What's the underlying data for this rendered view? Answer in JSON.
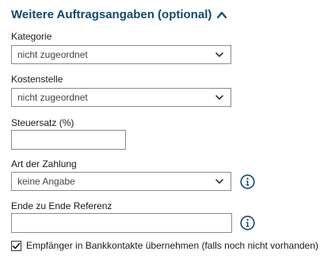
{
  "section": {
    "title": "Weitere Auftragsangaben (optional)",
    "expanded": true
  },
  "fields": {
    "kategorie": {
      "label": "Kategorie",
      "value": "nicht zugeordnet"
    },
    "kostenstelle": {
      "label": "Kostenstelle",
      "value": "nicht zugeordnet"
    },
    "steuersatz": {
      "label": "Steuersatz (%)",
      "value": ""
    },
    "zahlungsart": {
      "label": "Art der Zahlung",
      "value": "keine Angabe"
    },
    "referenz": {
      "label": "Ende zu Ende Referenz",
      "value": ""
    }
  },
  "checkbox": {
    "label": "Empfänger in Bankkontakte übernehmen (falls noch nicht vorhanden)",
    "checked": true
  },
  "colors": {
    "heading": "#0f4a6e",
    "info_icon": "#0f4a6e",
    "border": "#8a8a8a"
  },
  "icons": {
    "collapse": "chevron-up-icon",
    "dropdown": "chevron-down-icon",
    "info": "info-icon",
    "check": "checkmark-icon"
  }
}
